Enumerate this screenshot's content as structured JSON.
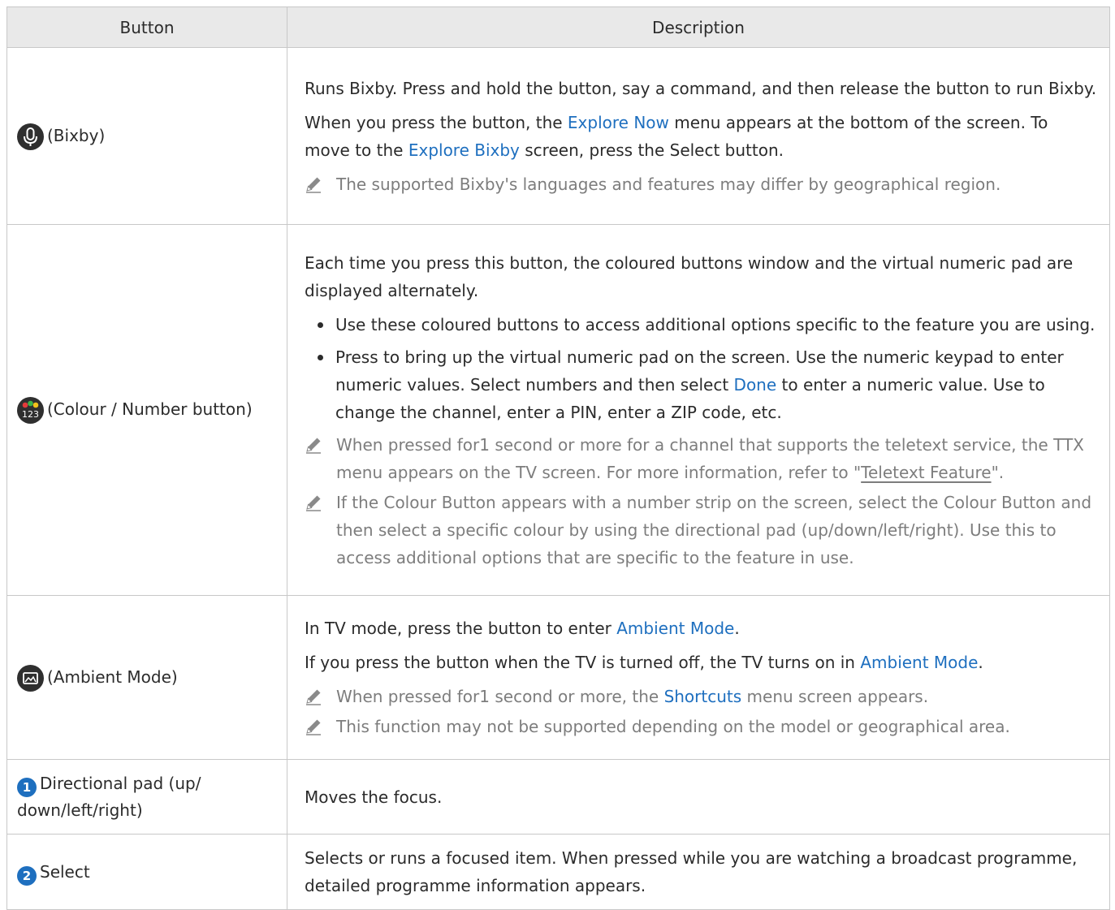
{
  "table": {
    "headers": [
      "Button",
      "Description"
    ],
    "rows": {
      "bixby": {
        "button_label": "(Bixby)",
        "icon": "microphone-icon",
        "p1": "Runs Bixby. Press and hold the button, say a command, and then release the button to run Bixby.",
        "p2_a": "When you press the button, the ",
        "p2_link1": "Explore Now",
        "p2_b": " menu appears at the bottom of the screen. To move to the ",
        "p2_link2": "Explore Bixby",
        "p2_c": " screen, press the Select button.",
        "note1": "The supported Bixby's languages and features may differ by geographical region."
      },
      "colour": {
        "button_label": "(Colour / Number button)",
        "icon": "colour-number-icon",
        "icon_text": "123",
        "p1": "Each time you press this button, the coloured buttons window and the virtual numeric pad are displayed alternately.",
        "bullet1": "Use these coloured buttons to access additional options specific to the feature you are using.",
        "bullet2_a": "Press to bring up the virtual numeric pad on the screen. Use the numeric keypad to enter numeric values. Select numbers and then select ",
        "bullet2_link": "Done",
        "bullet2_b": " to enter a numeric value. Use to change the channel, enter a PIN, enter a ZIP code, etc.",
        "note1_a": "When pressed for1 second or more for a channel that supports the teletext service, the TTX menu appears on the TV screen. For more information, refer to \"",
        "note1_link": "Teletext Feature",
        "note1_b": "\".",
        "note2": "If the Colour Button appears with a number strip on the screen, select the Colour Button and then select a specific colour by using the directional pad (up/down/left/right). Use this to access additional options that are specific to the feature in use."
      },
      "ambient": {
        "button_label": "(Ambient Mode)",
        "icon": "ambient-mode-icon",
        "p1_a": "In TV mode, press the button to enter ",
        "p1_link": "Ambient Mode",
        "p1_b": ".",
        "p2_a": "If you press the button when the TV is turned off, the TV turns on in ",
        "p2_link": "Ambient Mode",
        "p2_b": ".",
        "note1_a": "When pressed for1 second or more, the ",
        "note1_link": "Shortcuts",
        "note1_b": " menu screen appears.",
        "note2": "This function may not be supported depending on the model or geographical area."
      },
      "directional": {
        "badge": "1",
        "button_label": "Directional pad (up/ down/left/right)",
        "desc": "Moves the focus."
      },
      "select": {
        "badge": "2",
        "button_label": "Select",
        "desc": "Selects or runs a focused item. When pressed while you are watching a broadcast programme, detailed programme information appears."
      }
    }
  },
  "colors": {
    "link": "#1e6fbf",
    "note": "#7d7d7d",
    "header_bg": "#e9e9e9",
    "border": "#c8c8c8"
  }
}
